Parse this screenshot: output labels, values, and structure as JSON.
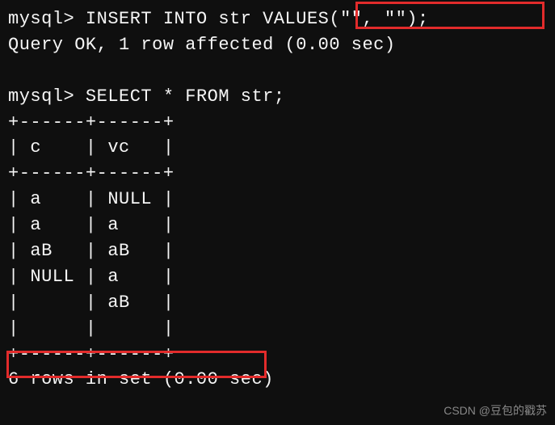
{
  "prompt": "mysql>",
  "stmt_insert": "INSERT INTO str VALUES(\"\", \"\");",
  "resp_insert": "Query OK, 1 row affected (0.00 sec)",
  "stmt_select": "SELECT * FROM str;",
  "table": {
    "border": "+------+------+",
    "header": "| c    | vc   |",
    "rows": [
      "| a    | NULL |",
      "| a    | a    |",
      "| aB   | aB   |",
      "| NULL | a    |",
      "|      | aB   |",
      "|      |      |"
    ]
  },
  "resp_select": "6 rows in set (0.00 sec)",
  "watermark": "CSDN @豆包的戳苏",
  "chart_data": {
    "type": "table",
    "columns": [
      "c",
      "vc"
    ],
    "rows": [
      [
        "a",
        null
      ],
      [
        "a",
        "a"
      ],
      [
        "aB",
        "aB"
      ],
      [
        null,
        "a"
      ],
      [
        "",
        "aB"
      ],
      [
        "",
        ""
      ]
    ],
    "row_count": 6,
    "elapsed_sec": 0.0
  }
}
